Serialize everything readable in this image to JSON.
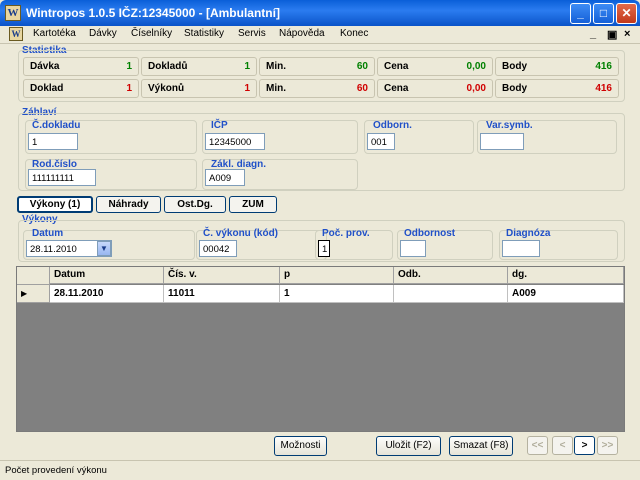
{
  "window": {
    "title": "Wintropos 1.0.5  IČZ:12345000 - [Ambulantní]",
    "app_icon": "W",
    "minimize": "_",
    "maximize": "□",
    "close": "✕"
  },
  "menu": {
    "items": [
      "Kartotéka",
      "Dávky",
      "Číselníky",
      "Statistiky",
      "Servis",
      "Nápověda",
      "Konec"
    ],
    "mdi_minimize": "_",
    "mdi_restore": "▣",
    "mdi_close": "×"
  },
  "statistika": {
    "title": "Statistika",
    "row1": [
      {
        "label": "Dávka",
        "value": "1",
        "color": "#008000"
      },
      {
        "label": "Dokladů",
        "value": "1",
        "color": "#008000"
      },
      {
        "label": "Min.",
        "value": "60",
        "color": "#008000"
      },
      {
        "label": "Cena",
        "value": "0,00",
        "color": "#008000"
      },
      {
        "label": "Body",
        "value": "416",
        "color": "#008000"
      }
    ],
    "row2": [
      {
        "label": "Doklad",
        "value": "1",
        "color": "#d00000"
      },
      {
        "label": "Výkonů",
        "value": "1",
        "color": "#d00000"
      },
      {
        "label": "Min.",
        "value": "60",
        "color": "#d00000"
      },
      {
        "label": "Cena",
        "value": "0,00",
        "color": "#d00000"
      },
      {
        "label": "Body",
        "value": "416",
        "color": "#d00000"
      }
    ]
  },
  "zahlavi": {
    "title": "Záhlaví",
    "c_dokladu": {
      "label": "Č.dokladu",
      "value": "1"
    },
    "icp": {
      "label": "IČP",
      "value": "12345000"
    },
    "odborn": {
      "label": "Odborn.",
      "value": "001"
    },
    "var_symb": {
      "label": "Var.symb.",
      "value": ""
    },
    "rod_cislo": {
      "label": "Rod.číslo",
      "value": "111111111"
    },
    "zakl_diagn": {
      "label": "Zákl. diagn.",
      "value": "A009"
    }
  },
  "tabs": [
    "Výkony (1)",
    "Náhrady",
    "Ost.Dg.",
    "ZUM"
  ],
  "vykony": {
    "title": "Výkony",
    "datum": {
      "label": "Datum",
      "value": "28.11.2010"
    },
    "c_vykonu": {
      "label": "Č. výkonu (kód)",
      "value": "00042"
    },
    "poc_prov": {
      "label": "Poč. prov.",
      "value": "1"
    },
    "odbornost": {
      "label": "Odbornost",
      "value": ""
    },
    "diagnoza": {
      "label": "Diagnóza",
      "value": ""
    }
  },
  "grid": {
    "columns": [
      "Datum",
      "Čís. v.",
      "p",
      "Odb.",
      "dg."
    ],
    "rows": [
      {
        "datum": "28.11.2010",
        "cis_v": "11011",
        "p": "1",
        "odb": "",
        "dg": "A009"
      }
    ],
    "row_indicator": "▶"
  },
  "buttons": {
    "moznosti": "Možnosti",
    "ulozit": "Uložit (F2)",
    "smazat": "Smazat (F8)",
    "first": "<<",
    "prev": "<",
    "next": ">",
    "last": ">>"
  },
  "status": "Počet provedení výkonu"
}
